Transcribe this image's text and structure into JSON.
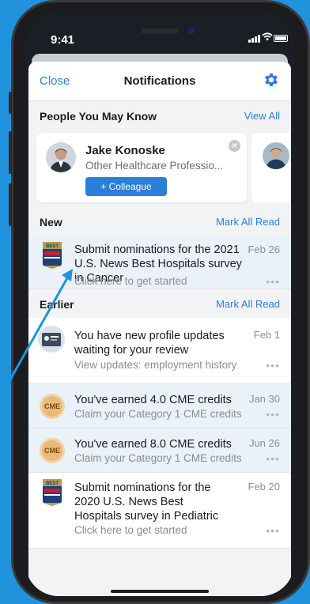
{
  "status": {
    "time": "9:41"
  },
  "nav": {
    "close": "Close",
    "title": "Notifications"
  },
  "people": {
    "title": "People You May Know",
    "view_all": "View All",
    "card": {
      "name": "Jake Konoske",
      "role": "Other Healthcare Professio...",
      "button": "+ Colleague"
    }
  },
  "new_section": {
    "title": "New",
    "mark_read": "Mark All Read",
    "items": [
      {
        "text": "Submit nominations for the 2021 U.S. News Best Hospitals survey in Cancer",
        "sub": "Click here to get started",
        "date": "Feb 26",
        "icon": "best-hospitals-badge-icon"
      }
    ]
  },
  "earlier_section": {
    "title": "Earlier",
    "mark_read": "Mark All Read",
    "items": [
      {
        "text": "You have new profile updates waiting for your review",
        "sub": "View updates: employment history",
        "date": "Feb 1",
        "icon": "profile-card-icon"
      },
      {
        "text": "You've earned 4.0 CME credits",
        "sub": "Claim your Category 1 CME credits",
        "date": "Jan 30",
        "icon": "cme-coin-icon",
        "coin": "CME"
      },
      {
        "text": "You've earned 8.0 CME credits",
        "sub": "Claim your Category 1 CME credits",
        "date": "Jun 26",
        "icon": "cme-coin-icon",
        "coin": "CME"
      },
      {
        "text": "Submit nominations for the 2020 U.S. News Best Hospitals survey in Pediatric",
        "sub": "Click here to get started",
        "date": "Feb 20",
        "icon": "best-hospitals-badge-icon"
      }
    ]
  },
  "more_dots": "•••",
  "colors": {
    "accent": "#2b7fd9",
    "background": "#2193dd",
    "highlight_row": "#eaf1f9"
  }
}
